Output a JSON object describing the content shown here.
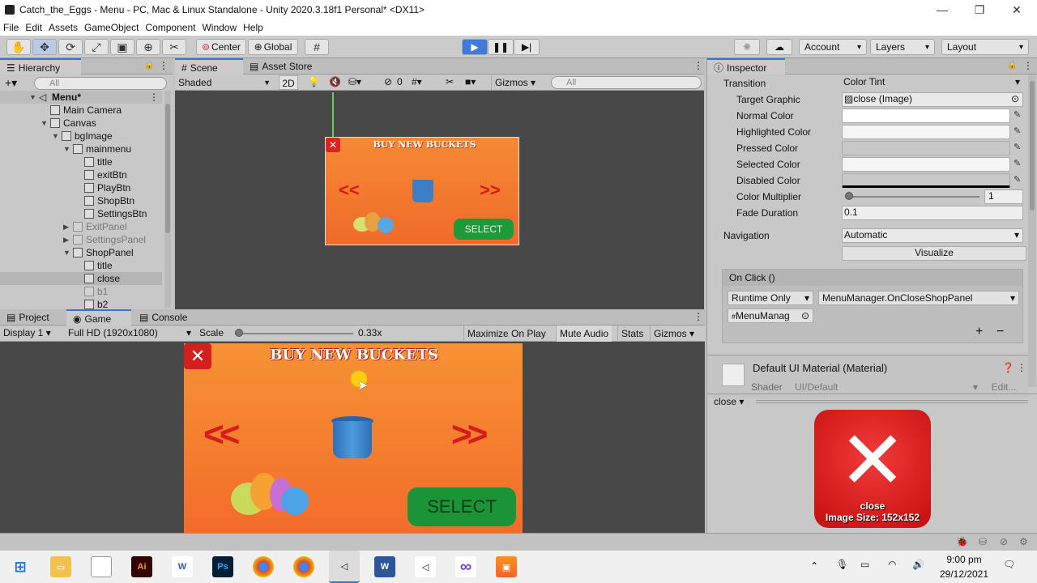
{
  "window": {
    "title": "Catch_the_Eggs - Menu - PC, Mac & Linux Standalone - Unity 2020.3.18f1 Personal* <DX11>",
    "min": "—",
    "max": "❐",
    "close": "✕"
  },
  "menu": [
    "File",
    "Edit",
    "Assets",
    "GameObject",
    "Component",
    "Window",
    "Help"
  ],
  "toolbar": {
    "center": "Center",
    "global": "Global",
    "account": "Account",
    "layers": "Layers",
    "layout": "Layout"
  },
  "hierarchy": {
    "tab": "Hierarchy",
    "search": "All",
    "rows": [
      {
        "label": "Menu*"
      },
      {
        "label": "Main Camera"
      },
      {
        "label": "Canvas"
      },
      {
        "label": "bgImage"
      },
      {
        "label": "mainmenu"
      },
      {
        "label": "title"
      },
      {
        "label": "exitBtn"
      },
      {
        "label": "PlayBtn"
      },
      {
        "label": "ShopBtn"
      },
      {
        "label": "SettingsBtn"
      },
      {
        "label": "ExitPanel"
      },
      {
        "label": "SettingsPanel"
      },
      {
        "label": "ShopPanel"
      },
      {
        "label": "title"
      },
      {
        "label": "close"
      },
      {
        "label": "b1"
      },
      {
        "label": "b2"
      }
    ]
  },
  "scene": {
    "tab_scene": "Scene",
    "tab_store": "Asset Store",
    "shading": "Shaded",
    "mode2d": "2D",
    "gizmos": "Gizmos",
    "search": "All",
    "hidden_count": "0",
    "canvas": {
      "title": "BUY NEW BUCKETS",
      "select": "SELECT",
      "left": "<<",
      "right": ">>"
    }
  },
  "game": {
    "tab_project": "Project",
    "tab_game": "Game",
    "tab_console": "Console",
    "display": "Display 1",
    "resolution": "Full HD (1920x1080)",
    "scale_label": "Scale",
    "scale_value": "0.33x",
    "scale_fraction": 0.0,
    "maximize": "Maximize On Play",
    "mute": "Mute Audio",
    "stats": "Stats",
    "gizmos": "Gizmos",
    "canvas": {
      "title": "BUY NEW BUCKETS",
      "select": "SELECT",
      "left": "<<",
      "right": ">>"
    }
  },
  "inspector": {
    "tab": "Inspector",
    "transition_label": "Transition",
    "transition_value": "Color Tint",
    "target_graphic_label": "Target Graphic",
    "target_graphic_value": "close (Image)",
    "colors": [
      {
        "label": "Normal Color",
        "color": "#ffffff"
      },
      {
        "label": "Highlighted Color",
        "color": "#f5f5f5"
      },
      {
        "label": "Pressed Color",
        "color": "#c8c8c8"
      },
      {
        "label": "Selected Color",
        "color": "#f5f5f5"
      },
      {
        "label": "Disabled Color",
        "color": "#c8c8c8"
      }
    ],
    "multiplier_label": "Color Multiplier",
    "multiplier_value": "1",
    "multiplier_fraction": 0.0,
    "fade_label": "Fade Duration",
    "fade_value": "0.1",
    "navigation_label": "Navigation",
    "navigation_value": "Automatic",
    "visualize": "Visualize",
    "onclick_header": "On Click ()",
    "runtime": "Runtime Only",
    "function": "MenuManager.OnCloseShopPanel",
    "object": "MenuManag",
    "add": "+",
    "remove": "−",
    "material_name": "Default UI Material (Material)",
    "shader_label": "Shader",
    "shader_value": "UI/Default",
    "edit": "Edit...",
    "preview_dropdown": "close",
    "preview_name": "close",
    "preview_size": "Image Size: 152x152"
  },
  "taskbar": {
    "time": "9:00 pm",
    "date": "29/12/2021"
  }
}
